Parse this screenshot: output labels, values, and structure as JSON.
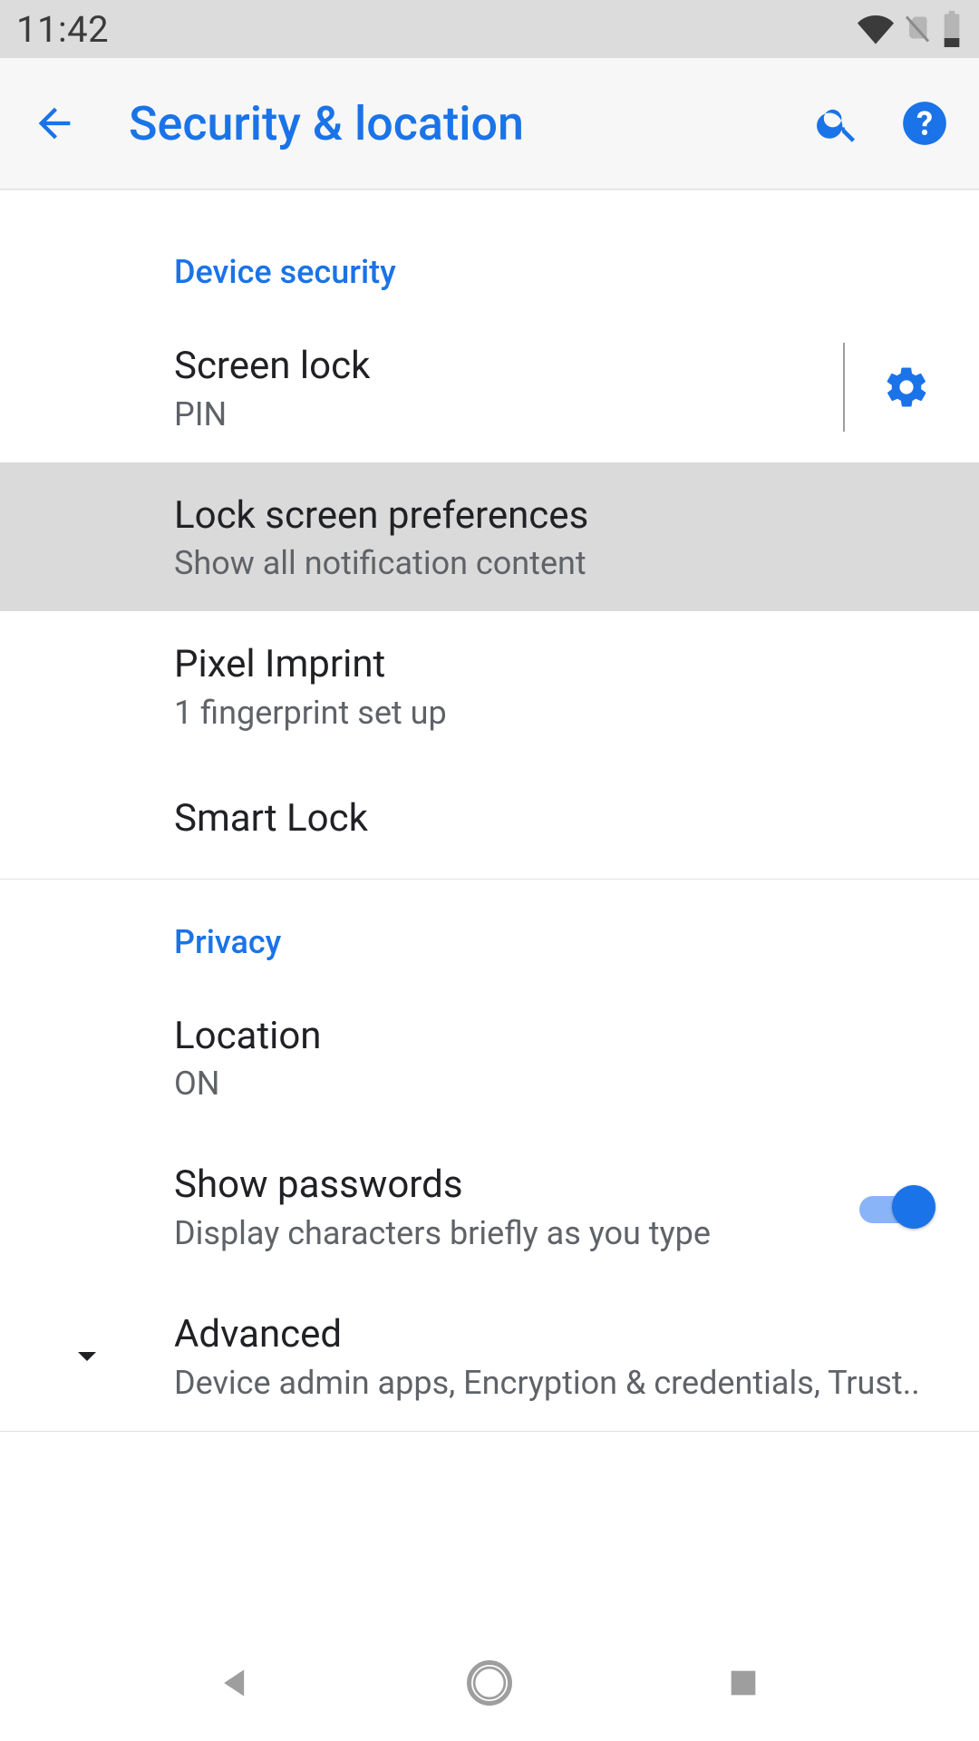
{
  "status": {
    "time": "11:42"
  },
  "appbar": {
    "title": "Security & location"
  },
  "sections": {
    "device_security": {
      "header": "Device security",
      "items": {
        "screen_lock": {
          "title": "Screen lock",
          "subtitle": "PIN"
        },
        "lock_prefs": {
          "title": "Lock screen preferences",
          "subtitle": "Show all notification content"
        },
        "pixel_imprint": {
          "title": "Pixel Imprint",
          "subtitle": "1 fingerprint set up"
        },
        "smart_lock": {
          "title": "Smart Lock"
        }
      }
    },
    "privacy": {
      "header": "Privacy",
      "items": {
        "location": {
          "title": "Location",
          "subtitle": "ON"
        },
        "show_passwords": {
          "title": "Show passwords",
          "subtitle": "Display characters briefly as you type",
          "switch_on": true
        },
        "advanced": {
          "title": "Advanced",
          "subtitle": "Device admin apps, Encryption & credentials, Trust.."
        }
      }
    }
  },
  "colors": {
    "accent": "#1a73e8"
  }
}
